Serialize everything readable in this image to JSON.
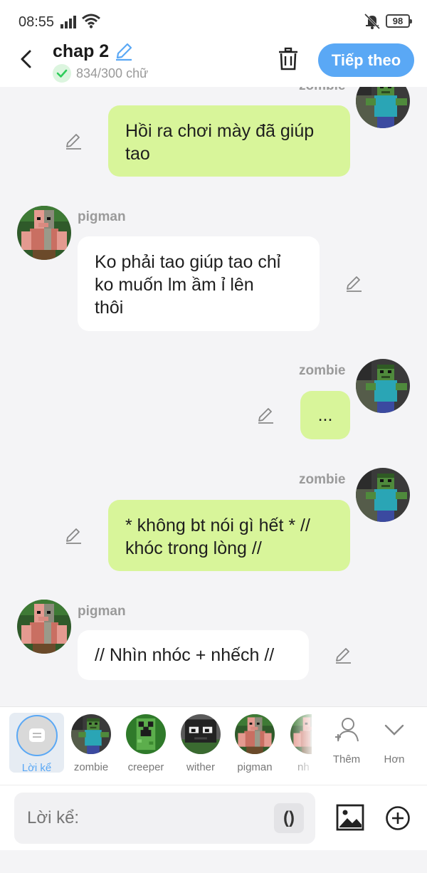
{
  "status": {
    "time": "08:55",
    "battery": "98"
  },
  "header": {
    "title": "chap 2",
    "word_count": "834/300 chữ",
    "next_label": "Tiếp theo"
  },
  "messages": [
    {
      "sender": "zombie",
      "text_lines": [
        "Hồi ra chơi mày đã giúp",
        "tao"
      ],
      "side": "right"
    },
    {
      "sender": "pigman",
      "text_lines": [
        "Ko phải tao giúp tao chỉ",
        "ko muốn lm ầm ỉ lên",
        "thôi"
      ],
      "side": "left"
    },
    {
      "sender": "zombie",
      "text_lines": [
        "..."
      ],
      "side": "right"
    },
    {
      "sender": "zombie",
      "text_lines": [
        "* không bt nói gì hết * //",
        "khóc trong lòng //"
      ],
      "side": "right"
    },
    {
      "sender": "pigman",
      "text_lines": [
        "// Nhìn nhóc + nhếch //"
      ],
      "side": "left"
    }
  ],
  "characters": {
    "narrator_label": "Lời kể",
    "items": [
      "zombie",
      "creeper",
      "wither",
      "pigman",
      "nh"
    ],
    "more_label": "Thêm",
    "expand_label": "Hơn"
  },
  "input": {
    "placeholder": "Lời kể:",
    "paren_label": "()"
  },
  "colors": {
    "accent": "#5aa8f5",
    "my_bubble": "#d8f59a",
    "other_bubble": "#ffffff"
  }
}
